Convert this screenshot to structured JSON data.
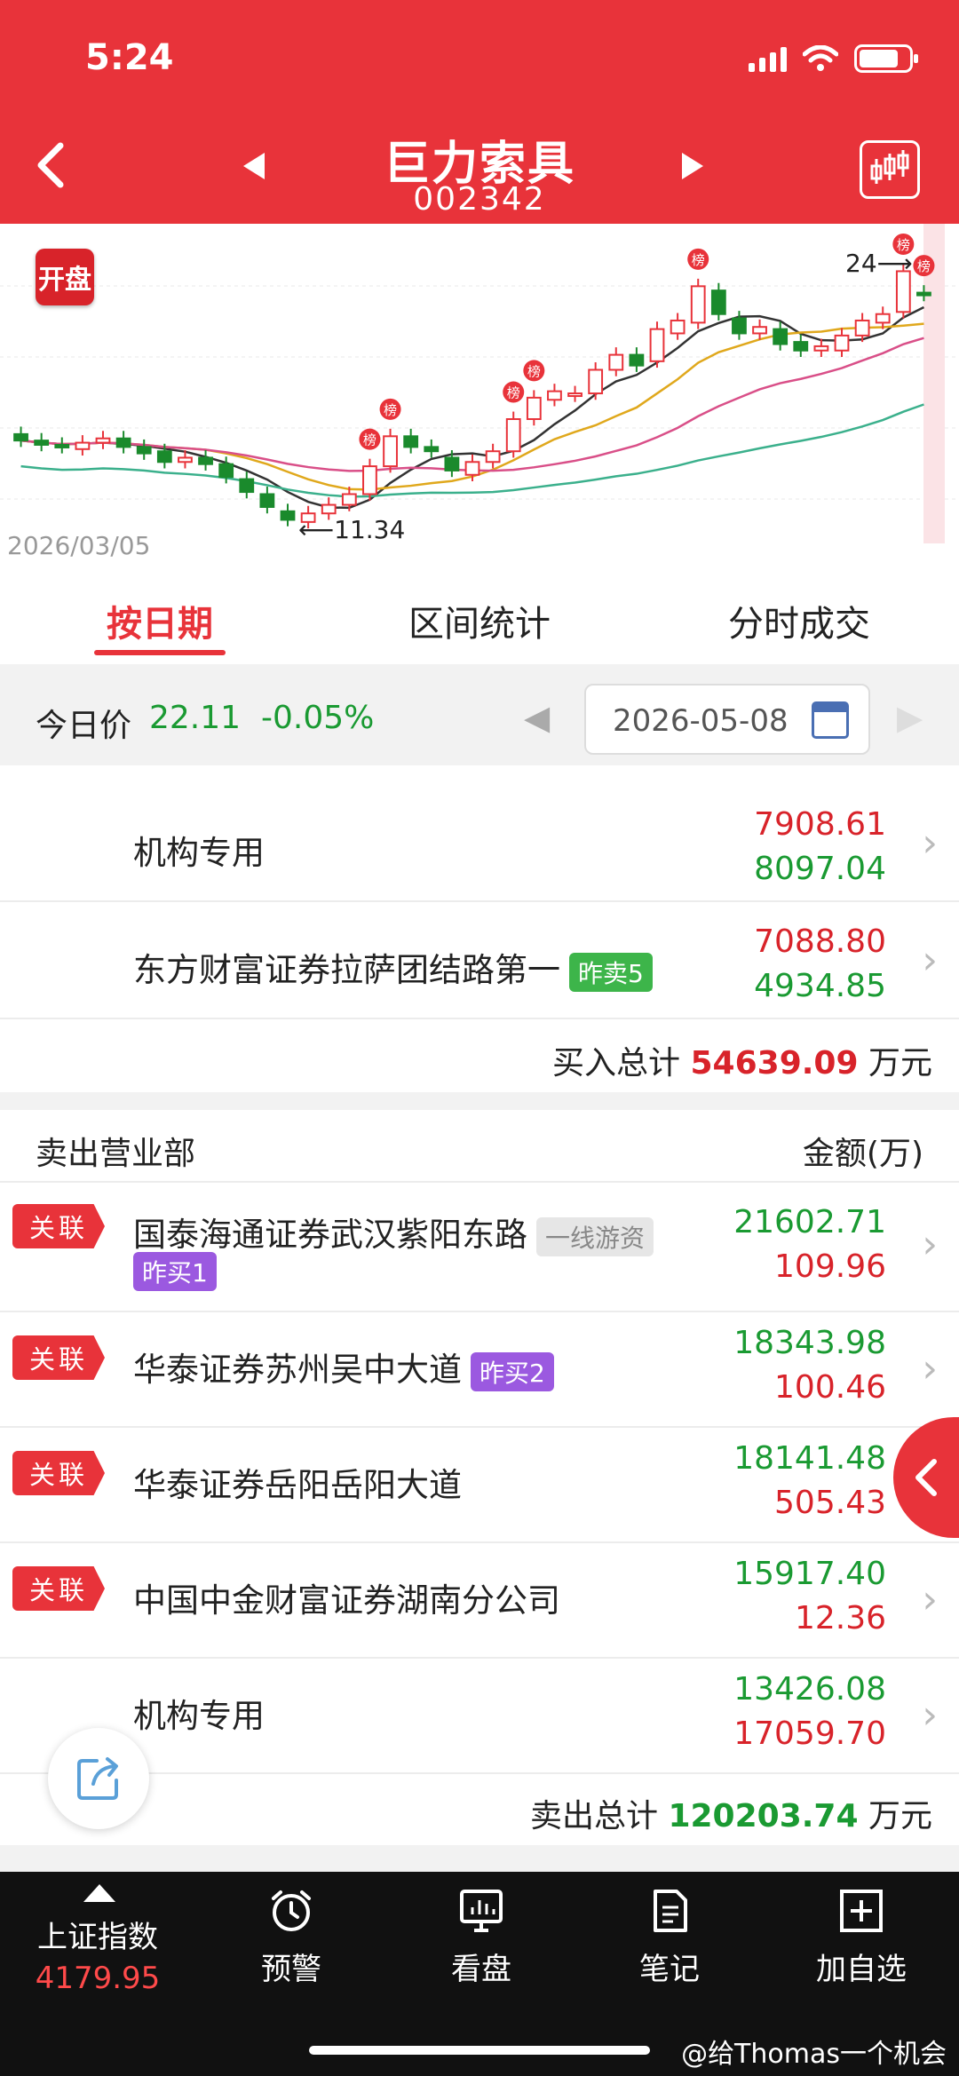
{
  "status": {
    "time": "5:24"
  },
  "header": {
    "title": "巨力索具",
    "code": "002342"
  },
  "chart": {
    "badge": "开盘",
    "start_date": "2026/03/05",
    "max_label": "24",
    "min_label": "11.34",
    "lhb_marker": "榜"
  },
  "chart_data": {
    "type": "candlestick",
    "start_date": "2026/03/05",
    "annotations": [
      {
        "label": "24",
        "kind": "max"
      },
      {
        "label": "11.34",
        "kind": "min"
      }
    ],
    "candles": [
      {
        "o": 15.6,
        "c": 15.3
      },
      {
        "o": 15.3,
        "c": 15.1
      },
      {
        "o": 15.1,
        "c": 15.0
      },
      {
        "o": 14.9,
        "c": 15.2
      },
      {
        "o": 15.2,
        "c": 15.4
      },
      {
        "o": 15.4,
        "c": 15.0
      },
      {
        "o": 15.0,
        "c": 14.7
      },
      {
        "o": 14.8,
        "c": 14.3
      },
      {
        "o": 14.3,
        "c": 14.5
      },
      {
        "o": 14.5,
        "c": 14.2
      },
      {
        "o": 14.2,
        "c": 13.6
      },
      {
        "o": 13.5,
        "c": 12.9
      },
      {
        "o": 12.8,
        "c": 12.2
      },
      {
        "o": 12.0,
        "c": 11.6
      },
      {
        "o": 11.5,
        "c": 11.9
      },
      {
        "o": 11.9,
        "c": 12.3
      },
      {
        "o": 12.3,
        "c": 12.8
      },
      {
        "o": 12.8,
        "c": 14.1
      },
      {
        "o": 14.1,
        "c": 15.5
      },
      {
        "o": 15.5,
        "c": 15.0
      },
      {
        "o": 15.0,
        "c": 14.8
      },
      {
        "o": 14.5,
        "c": 13.9
      },
      {
        "o": 13.7,
        "c": 14.3
      },
      {
        "o": 14.3,
        "c": 14.8
      },
      {
        "o": 14.8,
        "c": 16.3
      },
      {
        "o": 16.3,
        "c": 17.3
      },
      {
        "o": 17.2,
        "c": 17.6
      },
      {
        "o": 17.4,
        "c": 17.5
      },
      {
        "o": 17.5,
        "c": 18.6
      },
      {
        "o": 18.6,
        "c": 19.3
      },
      {
        "o": 19.3,
        "c": 18.8
      },
      {
        "o": 19.0,
        "c": 20.5
      },
      {
        "o": 20.3,
        "c": 20.9
      },
      {
        "o": 20.8,
        "c": 22.5
      },
      {
        "o": 22.3,
        "c": 21.2
      },
      {
        "o": 21.0,
        "c": 20.3
      },
      {
        "o": 20.3,
        "c": 20.6
      },
      {
        "o": 20.5,
        "c": 19.8
      },
      {
        "o": 19.9,
        "c": 19.5
      },
      {
        "o": 19.5,
        "c": 19.7
      },
      {
        "o": 19.5,
        "c": 20.2
      },
      {
        "o": 20.2,
        "c": 20.9
      },
      {
        "o": 20.8,
        "c": 21.2
      },
      {
        "o": 21.3,
        "c": 23.2
      },
      {
        "o": 22.2,
        "c": 22.1
      }
    ],
    "lhb_days": [
      17,
      18,
      24,
      25,
      33,
      43,
      44
    ]
  },
  "tabs": [
    {
      "label": "按日期",
      "active": true
    },
    {
      "label": "区间统计",
      "active": false
    },
    {
      "label": "分时成交",
      "active": false
    }
  ],
  "price_bar": {
    "label": "今日价",
    "price": "22.11",
    "change": "-0.05%",
    "date": "2026-05-08"
  },
  "buy_rows": [
    {
      "name": "机构专用",
      "tag": "",
      "top": "7908.61",
      "bottom": "8097.04"
    },
    {
      "name": "东方财富证券拉萨团结路第一",
      "tag": "昨卖5",
      "top": "7088.80",
      "bottom": "4934.85"
    }
  ],
  "buy_total": {
    "label": "买入总计",
    "value": "54639.09",
    "unit": "万元"
  },
  "sell_header": {
    "left": "卖出营业部",
    "right": "金额(万)"
  },
  "sell_rows": [
    {
      "related": "关联",
      "name": "国泰海通证券武汉紫阳东路",
      "tag_gray": "一线游资",
      "tag_purple": "昨买1",
      "top": "21602.71",
      "bottom": "109.96"
    },
    {
      "related": "关联",
      "name": "华泰证券苏州吴中大道",
      "tag_purple": "昨买2",
      "top": "18343.98",
      "bottom": "100.46"
    },
    {
      "related": "关联",
      "name": "华泰证券岳阳岳阳大道",
      "top": "18141.48",
      "bottom": "505.43"
    },
    {
      "related": "关联",
      "name": "中国中金财富证券湖南分公司",
      "top": "15917.40",
      "bottom": "12.36"
    },
    {
      "related": "",
      "name": "机构专用",
      "top": "13426.08",
      "bottom": "17059.70"
    }
  ],
  "sell_total": {
    "label": "卖出总计",
    "value": "120203.74",
    "unit": "万元"
  },
  "bottom_nav": {
    "index_name": "上证指数",
    "index_value": "4179.95",
    "items": [
      "预警",
      "看盘",
      "笔记",
      "加自选"
    ]
  },
  "watermark": "@给Thomas一个机会",
  "colors": {
    "brand": "#e8333a",
    "up": "#d8232a",
    "down": "#1a9a32"
  }
}
